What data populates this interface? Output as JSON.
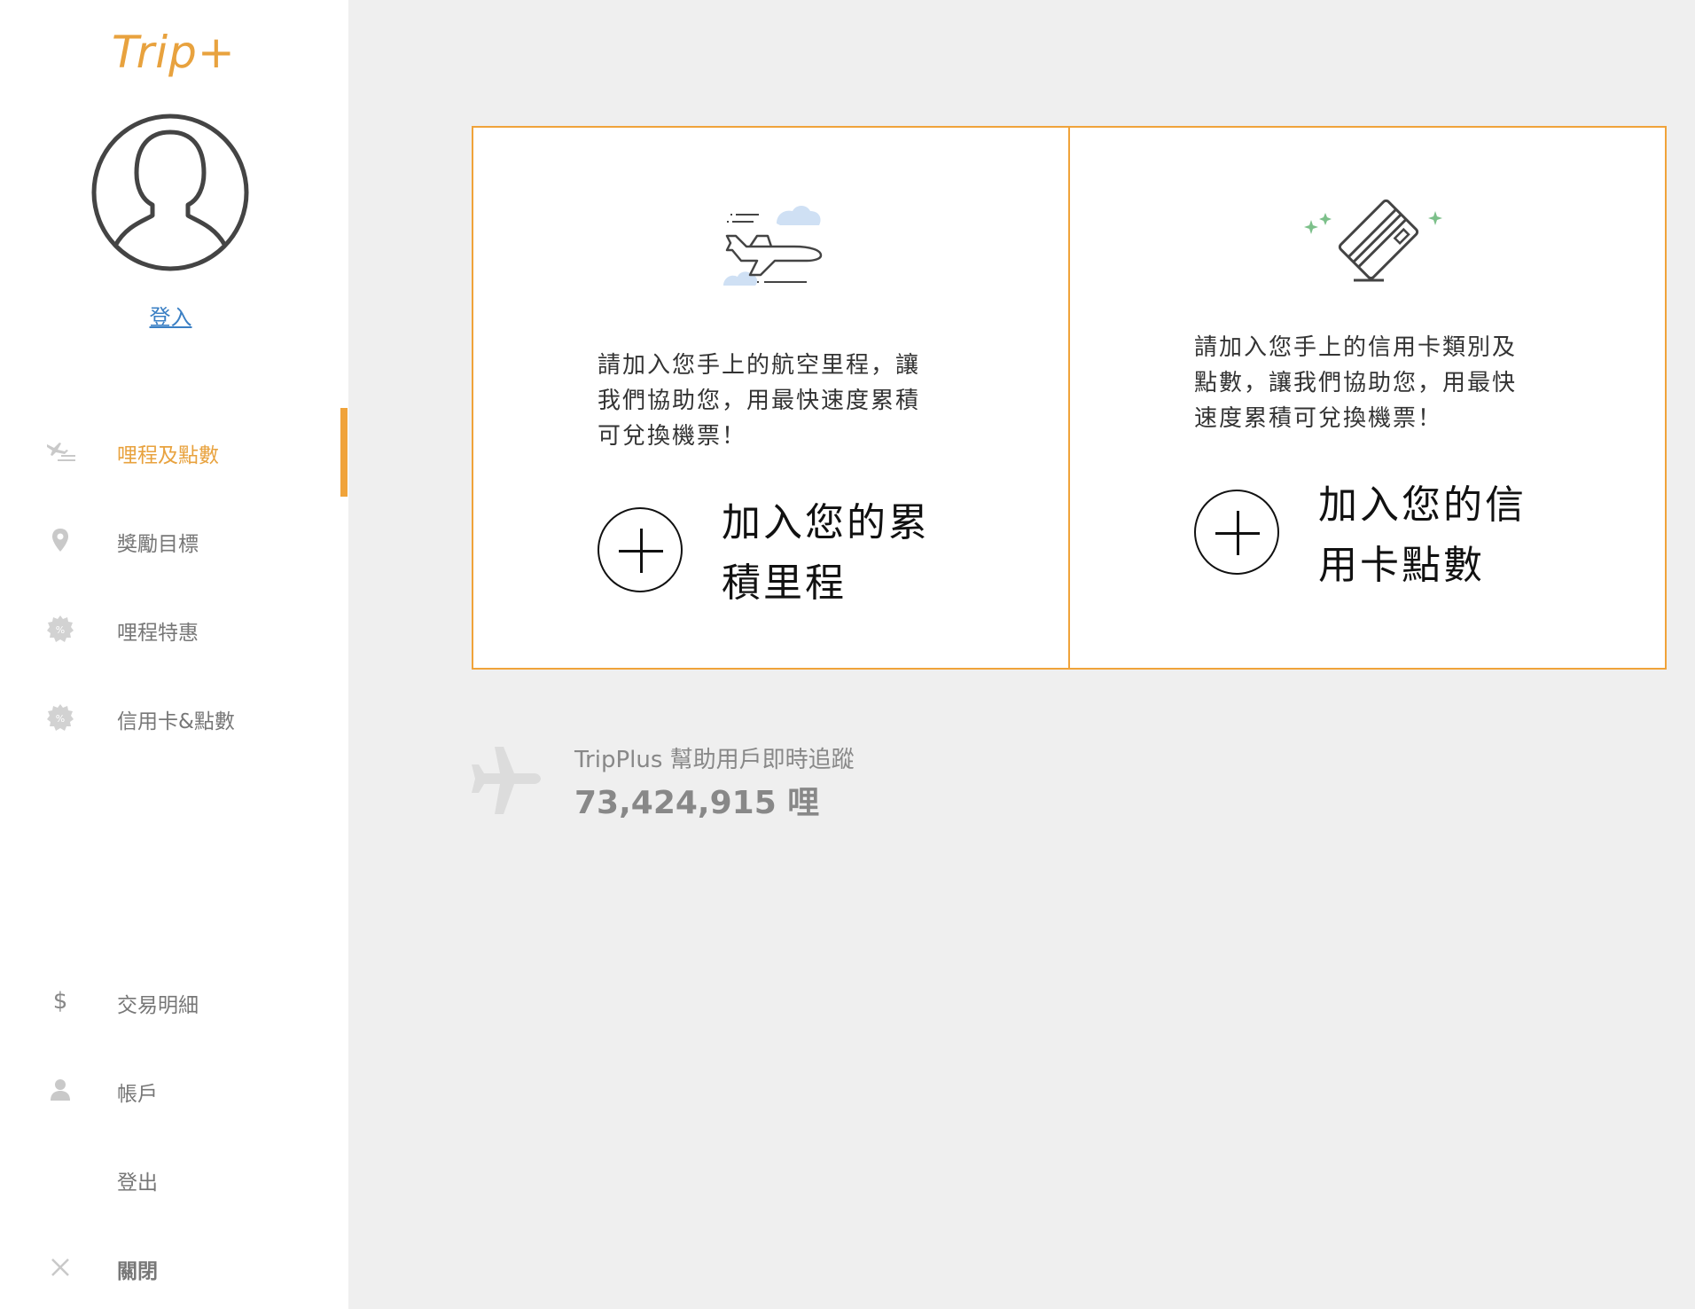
{
  "brand": {
    "logo_text": "Trip+"
  },
  "sidebar": {
    "login_label": "登入",
    "nav_items": [
      {
        "label": "哩程及點數",
        "icon": "plane-list-icon",
        "active": true
      },
      {
        "label": "獎勵目標",
        "icon": "location-pin-icon",
        "active": false
      },
      {
        "label": "哩程特惠",
        "icon": "discount-badge-icon",
        "active": false
      },
      {
        "label": "信用卡&點數",
        "icon": "discount-badge-icon",
        "active": false
      }
    ],
    "bottom_items": [
      {
        "label": "交易明細",
        "icon": "dollar-icon"
      },
      {
        "label": "帳戶",
        "icon": "user-icon"
      },
      {
        "label": "登出",
        "icon": ""
      },
      {
        "label": "關閉",
        "icon": "close-icon"
      }
    ]
  },
  "cards": [
    {
      "illustration": "airplane-clouds-icon",
      "description": "請加入您手上的航空里程，讓\n我們協助您，用最快速度累積\n可兌換機票！",
      "action_label": "加入您的累\n積里程"
    },
    {
      "illustration": "credit-card-sparkle-icon",
      "description": "請加入您手上的信用卡類別及\n點數，讓我們協助您，用最快\n速度累積可兌換機票！",
      "action_label": "加入您的信\n用卡點數"
    }
  ],
  "stats": {
    "caption": "TripPlus 幫助用戶即時追蹤",
    "value": "73,424,915 哩"
  },
  "colors": {
    "accent": "#f0a33a",
    "link": "#3a7fc4",
    "background": "#efefef"
  }
}
